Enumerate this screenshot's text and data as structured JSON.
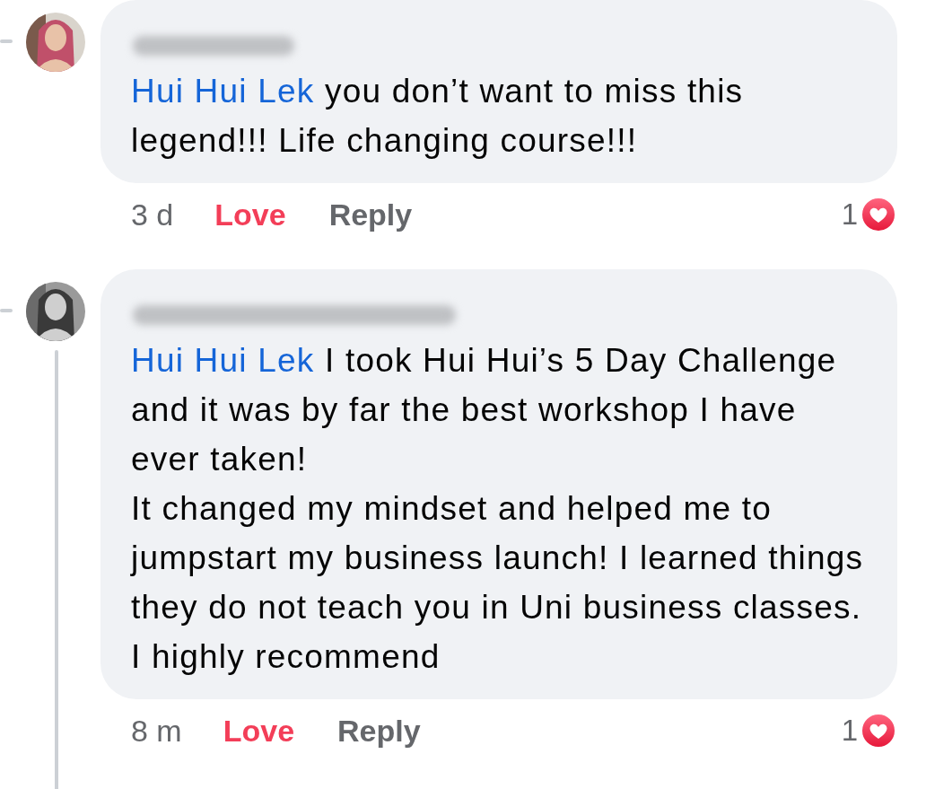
{
  "comments": [
    {
      "mention": "Hui Hui Lek",
      "text": "you don’t want to miss this legend!!! Life changing course!!!",
      "time": "3 d",
      "love_label": "Love",
      "loved": true,
      "reply_label": "Reply",
      "reaction_count": "1",
      "thread_line": false
    },
    {
      "mention": "Hui Hui Lek",
      "text": "I took Hui Hui’s 5 Day Challenge and it was by far the best workshop I have ever taken!\nIt changed my mindset and helped me to jumpstart my business launch! I learned things they do not teach you in Uni business classes.\nI highly recommend",
      "time": "8 m",
      "love_label": "Love",
      "loved": true,
      "reply_label": "Reply",
      "reaction_count": "1",
      "thread_line": true
    }
  ]
}
